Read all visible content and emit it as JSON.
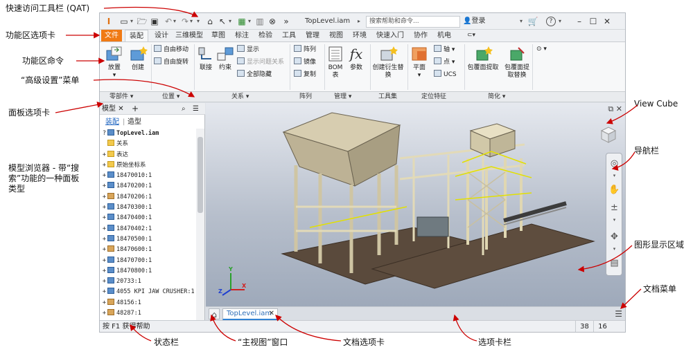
{
  "callouts": {
    "qat": "快速访问工具栏 (QAT)",
    "ribbon_tabs": "功能区选项卡",
    "ribbon_commands": "功能区命令",
    "advanced_menu": "“高级设置”菜单",
    "panel_tabs": "面板选项卡",
    "model_browser": "模型浏览器 - 带“搜索”功能的一种面板类型",
    "view_cube": "View Cube",
    "nav_bar": "导航栏",
    "graphics_area": "图形显示区域",
    "doc_menu": "文档菜单",
    "status_bar": "状态栏",
    "home_view": "“主视图”窗口",
    "doc_tab": "文档选项卡",
    "tab_bar": "选项卡栏"
  },
  "window": {
    "doc_name": "TopLevel.iam",
    "search_placeholder": "搜索帮助和命令...",
    "login": "登录",
    "help_icon": "?"
  },
  "ribbon_tabs": [
    "文件",
    "装配",
    "设计",
    "三维模型",
    "草图",
    "标注",
    "检验",
    "工具",
    "管理",
    "视图",
    "环境",
    "快速入门",
    "协作",
    "机电"
  ],
  "ribbon": {
    "place": "放置",
    "create": "创建",
    "free_move": "自由移动",
    "free_rotate": "自由旋转",
    "joint": "联接",
    "constrain": "约束",
    "show": "显示",
    "show_sick": "显示问题关系",
    "hide_all": "全部隐藏",
    "pattern": "阵列",
    "mirror": "镜像",
    "copy": "复制",
    "bom": "BOM 表",
    "params": "参数",
    "create_deriv": "创建衍生替换",
    "plane": "平面",
    "axis": "轴",
    "point": "点",
    "ucs": "UCS",
    "shrinkwrap": "包覆面提取",
    "shrinkwrap_sub": "包覆面提取替换"
  },
  "group_titles": {
    "component": "零部件",
    "position": "位置",
    "relationships": "关系",
    "pattern": "阵列",
    "manage": "管理",
    "productivity": "工具集",
    "work_features": "定位特征",
    "simplification": "简化"
  },
  "panel": {
    "tab_label": "模型",
    "sub_assembly": "装配",
    "sub_modeling": "造型",
    "tree": [
      {
        "label": "TopLevel.iam",
        "type": "asm",
        "expand": "?",
        "bold": true
      },
      {
        "label": "关系",
        "type": "folder",
        "expand": ""
      },
      {
        "label": "表达",
        "type": "folder",
        "expand": "+"
      },
      {
        "label": "原始坐标系",
        "type": "folder",
        "expand": "+"
      },
      {
        "label": "18470010:1",
        "type": "asm",
        "expand": "+"
      },
      {
        "label": "18470200:1",
        "type": "asm",
        "expand": "+"
      },
      {
        "label": "18470206:1",
        "type": "part",
        "expand": "+"
      },
      {
        "label": "18470300:1",
        "type": "asm",
        "expand": "+"
      },
      {
        "label": "18470400:1",
        "type": "asm",
        "expand": "+"
      },
      {
        "label": "18470402:1",
        "type": "asm",
        "expand": "+"
      },
      {
        "label": "18470500:1",
        "type": "asm",
        "expand": "+"
      },
      {
        "label": "18470600:1",
        "type": "part",
        "expand": "+"
      },
      {
        "label": "18470700:1",
        "type": "asm",
        "expand": "+"
      },
      {
        "label": "18470800:1",
        "type": "asm",
        "expand": "+"
      },
      {
        "label": "20733:1",
        "type": "asm",
        "expand": "+"
      },
      {
        "label": "4055 KPI JAW CRUSHER:1",
        "type": "asm",
        "expand": "+"
      },
      {
        "label": "48156:1",
        "type": "part",
        "expand": "+"
      },
      {
        "label": "48287:1",
        "type": "part",
        "expand": "+"
      }
    ]
  },
  "doc_tab": {
    "label": "TopLevel.iam"
  },
  "status": {
    "help_text": "按 F1 获得帮助",
    "count1": "38",
    "count2": "16"
  },
  "triad": {
    "x": "X",
    "y": "Y",
    "z": "Z"
  },
  "colors": {
    "file_tab": "#f07a14",
    "accent_blue": "#2f82d6",
    "arrow_red": "#cc0000"
  }
}
